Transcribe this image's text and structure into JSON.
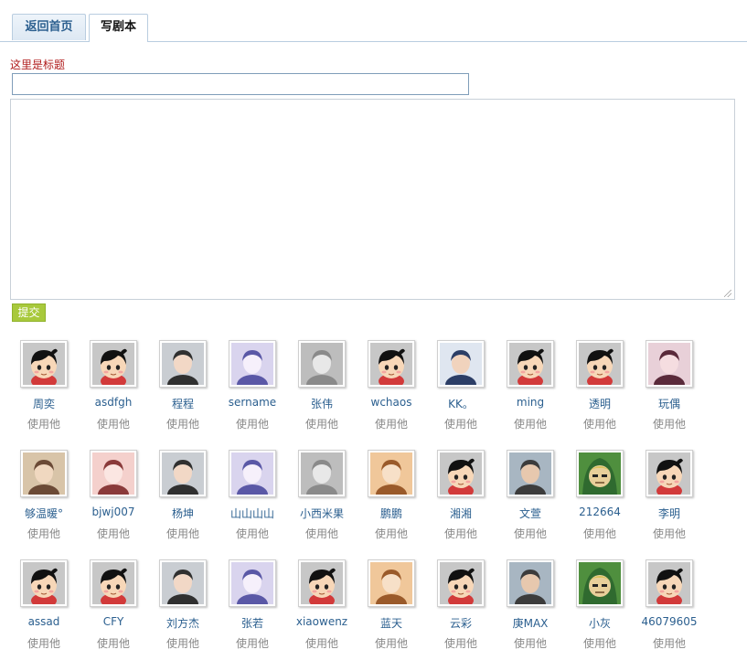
{
  "tabs": [
    {
      "label": "返回首页",
      "active": false
    },
    {
      "label": "写剧本",
      "active": true
    }
  ],
  "form": {
    "title_label": "这里是标题",
    "title_value": "",
    "body_value": "",
    "submit_label": "提交"
  },
  "colors": {
    "accent": "#2b5f8f",
    "title_label": "#b01c1c",
    "submit_bg": "#a8c93c"
  },
  "users": [
    {
      "name": "周奕",
      "action": "使用他",
      "avatar": "default-cartoon"
    },
    {
      "name": "asdfgh",
      "action": "使用他",
      "avatar": "default-cartoon"
    },
    {
      "name": "程程",
      "action": "使用他",
      "avatar": "photo"
    },
    {
      "name": "sername",
      "action": "使用他",
      "avatar": "photo"
    },
    {
      "name": "张伟",
      "action": "使用他",
      "avatar": "photo"
    },
    {
      "name": "wchaos",
      "action": "使用他",
      "avatar": "default-cartoon"
    },
    {
      "name": "KK。",
      "action": "使用他",
      "avatar": "photo"
    },
    {
      "name": "ming",
      "action": "使用他",
      "avatar": "default-cartoon"
    },
    {
      "name": "透明",
      "action": "使用他",
      "avatar": "default-cartoon"
    },
    {
      "name": "玩偶",
      "action": "使用他",
      "avatar": "photo"
    },
    {
      "name": "够温暖°",
      "action": "使用他",
      "avatar": "photo"
    },
    {
      "name": "bjwj007",
      "action": "使用他",
      "avatar": "photo"
    },
    {
      "name": "杨坤",
      "action": "使用他",
      "avatar": "photo"
    },
    {
      "name": "山山山山",
      "action": "使用他",
      "avatar": "photo"
    },
    {
      "name": "小西米果",
      "action": "使用他",
      "avatar": "photo"
    },
    {
      "name": "鹏鹏",
      "action": "使用他",
      "avatar": "photo"
    },
    {
      "name": "湘湘",
      "action": "使用他",
      "avatar": "default-cartoon"
    },
    {
      "name": "文萱",
      "action": "使用他",
      "avatar": "photo"
    },
    {
      "name": "212664",
      "action": "使用他",
      "avatar": "cartoon-character"
    },
    {
      "name": "李明",
      "action": "使用他",
      "avatar": "default-cartoon"
    },
    {
      "name": "assad",
      "action": "使用他",
      "avatar": "default-cartoon"
    },
    {
      "name": "CFY",
      "action": "使用他",
      "avatar": "default-cartoon"
    },
    {
      "name": "刘方杰",
      "action": "使用他",
      "avatar": "photo"
    },
    {
      "name": "张若",
      "action": "使用他",
      "avatar": "photo"
    },
    {
      "name": "xiaowenz",
      "action": "使用他",
      "avatar": "default-cartoon"
    },
    {
      "name": "蓝天",
      "action": "使用他",
      "avatar": "photo"
    },
    {
      "name": "云彩",
      "action": "使用他",
      "avatar": "default-cartoon"
    },
    {
      "name": "庚MAX",
      "action": "使用他",
      "avatar": "photo"
    },
    {
      "name": "小灰",
      "action": "使用他",
      "avatar": "cartoon-character"
    },
    {
      "name": "46079605",
      "action": "使用他",
      "avatar": "default-cartoon"
    }
  ]
}
